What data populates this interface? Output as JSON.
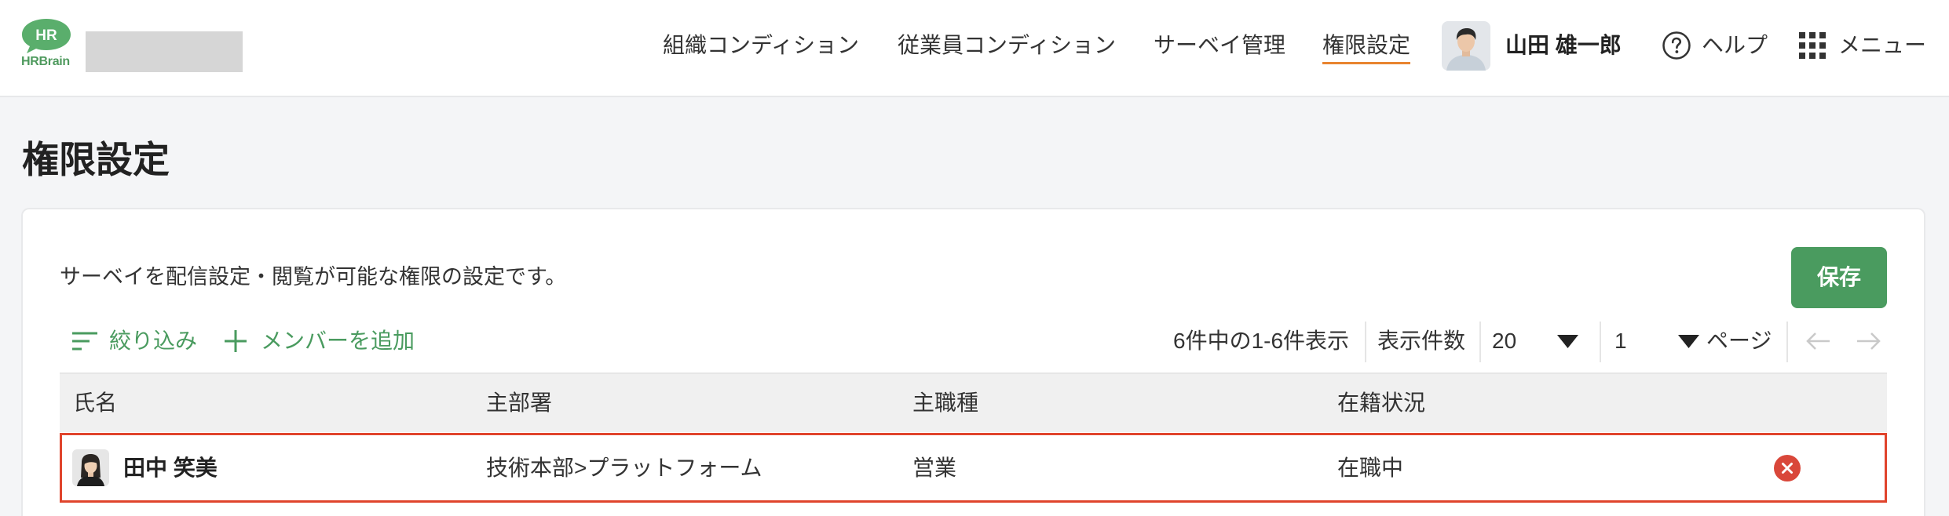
{
  "app": {
    "logo": {
      "bubble_text": "HR",
      "wordmark": "HRBrain"
    }
  },
  "header": {
    "nav": [
      {
        "label": "組織コンディション",
        "active": false
      },
      {
        "label": "従業員コンディション",
        "active": false
      },
      {
        "label": "サーベイ管理",
        "active": false
      },
      {
        "label": "権限設定",
        "active": true
      }
    ],
    "user": {
      "name": "山田 雄一郎",
      "avatar_icon": "person-avatar-icon"
    },
    "help": {
      "label": "ヘルプ",
      "icon": "help-circle-icon"
    },
    "menu": {
      "label": "メニュー",
      "icon": "grid-menu-icon"
    }
  },
  "page": {
    "title": "権限設定",
    "description": "サーベイを配信設定・閲覧が可能な権限の設定です。",
    "save_label": "保存"
  },
  "toolbar": {
    "filter": {
      "label": "絞り込み",
      "icon": "filter-icon"
    },
    "add_member": {
      "label": "メンバーを追加",
      "icon": "plus-icon"
    }
  },
  "pagination": {
    "summary": "6件中の1-6件表示",
    "per_page_label": "表示件数",
    "per_page_value": "20",
    "page_value": "1",
    "page_suffix": "ページ",
    "prev_enabled": false,
    "next_enabled": false
  },
  "table": {
    "columns": [
      "氏名",
      "主部署",
      "主職種",
      "在籍状況"
    ],
    "rows": [
      {
        "name": "田中 笑美",
        "department": "技術本部>プラットフォーム",
        "job_type": "営業",
        "status": "在職中",
        "highlighted": true,
        "avatar_icon": "person-avatar-icon",
        "remove_icon": "remove-circle-icon"
      }
    ]
  },
  "colors": {
    "accent_green": "#4a9b5f",
    "active_underline": "#e8842f",
    "highlight_border": "#e0442c",
    "remove_icon": "#d9473a",
    "page_background": "#f4f5f7"
  }
}
